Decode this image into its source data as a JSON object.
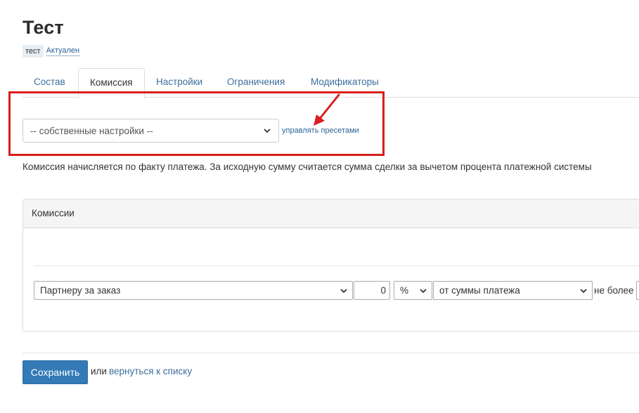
{
  "page": {
    "title": "Тест"
  },
  "tags": {
    "tag_label": "тест",
    "status_label": "Актуален"
  },
  "tabs": [
    {
      "label": "Состав"
    },
    {
      "label": "Комиссия"
    },
    {
      "label": "Настройки"
    },
    {
      "label": "Ограничения"
    },
    {
      "label": "Модификаторы"
    }
  ],
  "active_tab": "Комиссия",
  "preset": {
    "selected": "-- собственные настройки --",
    "manage_link": "управлять пресетами"
  },
  "description": "Комиссия начисляется по факту платежа. За исходную сумму считается сумма сделки за вычетом процента платежной системы",
  "commissions": {
    "panel_title": "Комиссии",
    "rule": {
      "recipient": "Партнеру за заказ",
      "amount": "0",
      "unit": "%",
      "base": "от суммы платежа",
      "limit_label": "не более"
    }
  },
  "footer": {
    "save_label": "Сохранить",
    "or_label": "или",
    "back_label": "вернуться к списку"
  },
  "colors": {
    "accent": "#337ab7",
    "link": "#3d6f9c",
    "highlight": "#d81e1e"
  },
  "icons": [
    "chevron-down-icon",
    "arrow-annotation-icon"
  ]
}
